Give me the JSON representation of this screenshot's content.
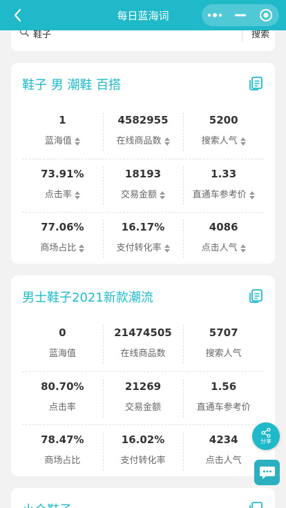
{
  "nav": {
    "title": "每日蓝海词"
  },
  "search": {
    "value": "鞋子",
    "button": "搜索"
  },
  "cards": [
    {
      "title": "鞋子 男 潮鞋 百搭",
      "rows": [
        [
          {
            "value": "1",
            "label": "蓝海值"
          },
          {
            "value": "4582955",
            "label": "在线商品数"
          },
          {
            "value": "5200",
            "label": "搜索人气"
          }
        ],
        [
          {
            "value": "73.91%",
            "label": "点击率"
          },
          {
            "value": "18193",
            "label": "交易金额"
          },
          {
            "value": "1.33",
            "label": "直通车参考价"
          }
        ],
        [
          {
            "value": "77.06%",
            "label": "商场占比"
          },
          {
            "value": "16.17%",
            "label": "支付转化率"
          },
          {
            "value": "4086",
            "label": "点击人气"
          }
        ]
      ]
    },
    {
      "title": "男士鞋子2021新款潮流",
      "rows": [
        [
          {
            "value": "0",
            "label": "蓝海值"
          },
          {
            "value": "21474505",
            "label": "在线商品数"
          },
          {
            "value": "5707",
            "label": "搜索人气"
          }
        ],
        [
          {
            "value": "80.70%",
            "label": "点击率"
          },
          {
            "value": "21269",
            "label": "交易金额"
          },
          {
            "value": "1.56",
            "label": "直通车参考价"
          }
        ],
        [
          {
            "value": "78.47%",
            "label": "商场占比"
          },
          {
            "value": "16.02%",
            "label": "支付转化率"
          },
          {
            "value": "4234",
            "label": "点击人气"
          }
        ]
      ]
    },
    {
      "title": "小众鞋子"
    }
  ],
  "fab": {
    "share_label": "分享"
  },
  "colors": {
    "brand": "#1fb9c9"
  }
}
